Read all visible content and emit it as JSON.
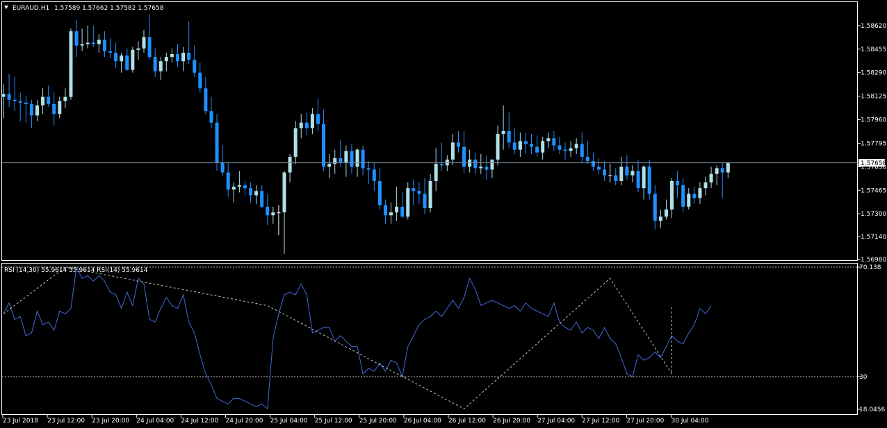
{
  "header": {
    "symbol": "EURAUD,H1",
    "ohlc": "1.57589 1.57662 1.57582 1.57658"
  },
  "price_axis": {
    "ticks": [
      "1.58620",
      "1.58455",
      "1.58290",
      "1.58125",
      "1.57960",
      "1.57795",
      "1.57630",
      "1.57465",
      "1.57300",
      "1.57140",
      "1.56980"
    ],
    "current": "1.57658"
  },
  "rsi": {
    "label": "RSI (14,30) 55.9614 55.9614  RSI(14) 55.9614",
    "ticks": [
      "70.138",
      "30",
      "18.0456"
    ]
  },
  "time_axis": {
    "labels": [
      "23 Jul 2018",
      "23 Jul 12:00",
      "23 Jul 20:00",
      "24 Jul 04:00",
      "24 Jul 12:00",
      "24 Jul 20:00",
      "25 Jul 04:00",
      "25 Jul 12:00",
      "25 Jul 20:00",
      "26 Jul 04:00",
      "26 Jul 12:00",
      "26 Jul 20:00",
      "27 Jul 04:00",
      "27 Jul 12:00",
      "27 Jul 20:00",
      "30 Jul 04:00"
    ]
  },
  "colors": {
    "bull": "#b0e0e6",
    "bear": "#1e90ff",
    "doji": "#ffffff",
    "rsi_line": "#4169e1",
    "price_line": "#778899",
    "axis": "#ffffff"
  },
  "chart_data": [
    {
      "type": "candlestick",
      "title": "EURAUD,H1",
      "ylim": [
        1.5698,
        1.5878
      ],
      "candles": [
        [
          1.5812,
          1.5821,
          1.5797,
          1.5814
        ],
        [
          1.5814,
          1.5828,
          1.5805,
          1.581
        ],
        [
          1.581,
          1.5826,
          1.5802,
          1.5809
        ],
        [
          1.5809,
          1.5815,
          1.5795,
          1.5808
        ],
        [
          1.5808,
          1.5813,
          1.5794,
          1.5807
        ],
        [
          1.5807,
          1.581,
          1.579,
          1.5799
        ],
        [
          1.5799,
          1.581,
          1.5795,
          1.5806
        ],
        [
          1.5806,
          1.5818,
          1.58,
          1.5812
        ],
        [
          1.5812,
          1.582,
          1.5805,
          1.5807
        ],
        [
          1.5807,
          1.5815,
          1.5792,
          1.58
        ],
        [
          1.58,
          1.5812,
          1.5797,
          1.5809
        ],
        [
          1.5809,
          1.5818,
          1.5804,
          1.5812
        ],
        [
          1.5812,
          1.586,
          1.581,
          1.5858
        ],
        [
          1.5858,
          1.5866,
          1.584,
          1.5848
        ],
        [
          1.5848,
          1.586,
          1.5844,
          1.5849
        ],
        [
          1.5849,
          1.5862,
          1.5846,
          1.585
        ],
        [
          1.585,
          1.5862,
          1.5847,
          1.5849
        ],
        [
          1.5849,
          1.5856,
          1.5843,
          1.5852
        ],
        [
          1.5852,
          1.5858,
          1.584,
          1.5844
        ],
        [
          1.5844,
          1.5853,
          1.5839,
          1.5843
        ],
        [
          1.5843,
          1.585,
          1.5832,
          1.5837
        ],
        [
          1.5837,
          1.5843,
          1.5829,
          1.5841
        ],
        [
          1.5841,
          1.5846,
          1.583,
          1.5831
        ],
        [
          1.5831,
          1.5847,
          1.5829,
          1.5845
        ],
        [
          1.5845,
          1.5851,
          1.5838,
          1.5846
        ],
        [
          1.5846,
          1.5859,
          1.5843,
          1.5854
        ],
        [
          1.5854,
          1.587,
          1.5838,
          1.584
        ],
        [
          1.584,
          1.5846,
          1.5826,
          1.583
        ],
        [
          1.583,
          1.584,
          1.5824,
          1.5837
        ],
        [
          1.5837,
          1.5843,
          1.583,
          1.584
        ],
        [
          1.584,
          1.5846,
          1.5836,
          1.5842
        ],
        [
          1.5842,
          1.5849,
          1.5833,
          1.5837
        ],
        [
          1.5837,
          1.5847,
          1.583,
          1.5843
        ],
        [
          1.5843,
          1.5865,
          1.5835,
          1.5838
        ],
        [
          1.5838,
          1.5848,
          1.5826,
          1.5829
        ],
        [
          1.5829,
          1.5836,
          1.5815,
          1.5818
        ],
        [
          1.5818,
          1.5826,
          1.58,
          1.5802
        ],
        [
          1.5802,
          1.5812,
          1.579,
          1.5794
        ],
        [
          1.5794,
          1.58,
          1.576,
          1.5766
        ],
        [
          1.5766,
          1.5778,
          1.5757,
          1.5759
        ],
        [
          1.5759,
          1.5766,
          1.5742,
          1.5747
        ],
        [
          1.5747,
          1.5752,
          1.5738,
          1.5749
        ],
        [
          1.5749,
          1.576,
          1.5745,
          1.575
        ],
        [
          1.575,
          1.5753,
          1.5743,
          1.5748
        ],
        [
          1.5748,
          1.5752,
          1.5738,
          1.5743
        ],
        [
          1.5743,
          1.575,
          1.5737,
          1.5746
        ],
        [
          1.5746,
          1.575,
          1.5734,
          1.5735
        ],
        [
          1.5735,
          1.5744,
          1.5722,
          1.5729
        ],
        [
          1.5729,
          1.5735,
          1.5723,
          1.5731
        ],
        [
          1.5731,
          1.5736,
          1.5715,
          1.5731
        ],
        [
          1.5731,
          1.576,
          1.5702,
          1.5759
        ],
        [
          1.5759,
          1.5772,
          1.5752,
          1.577
        ],
        [
          1.577,
          1.5795,
          1.5765,
          1.579
        ],
        [
          1.579,
          1.58,
          1.5783,
          1.5794
        ],
        [
          1.5794,
          1.5801,
          1.5785,
          1.579
        ],
        [
          1.579,
          1.5804,
          1.5786,
          1.58
        ],
        [
          1.58,
          1.5811,
          1.5788,
          1.5793
        ],
        [
          1.5793,
          1.5803,
          1.576,
          1.5763
        ],
        [
          1.5763,
          1.5772,
          1.5755,
          1.5765
        ],
        [
          1.5765,
          1.5775,
          1.5758,
          1.5769
        ],
        [
          1.5769,
          1.5782,
          1.5763,
          1.5766
        ],
        [
          1.5766,
          1.5778,
          1.5756,
          1.5774
        ],
        [
          1.5774,
          1.5779,
          1.5758,
          1.5763
        ],
        [
          1.5763,
          1.5776,
          1.5756,
          1.5775
        ],
        [
          1.5775,
          1.5778,
          1.5757,
          1.5762
        ],
        [
          1.5762,
          1.5767,
          1.5751,
          1.5761
        ],
        [
          1.5761,
          1.5766,
          1.5746,
          1.5753
        ],
        [
          1.5753,
          1.5762,
          1.5733,
          1.5736
        ],
        [
          1.5736,
          1.574,
          1.5723,
          1.5729
        ],
        [
          1.5729,
          1.5738,
          1.5723,
          1.5731
        ],
        [
          1.5731,
          1.5749,
          1.5725,
          1.5735
        ],
        [
          1.5735,
          1.5745,
          1.5727,
          1.5728
        ],
        [
          1.5728,
          1.5752,
          1.5726,
          1.5748
        ],
        [
          1.5748,
          1.5754,
          1.5736,
          1.5746
        ],
        [
          1.5746,
          1.5752,
          1.5737,
          1.5744
        ],
        [
          1.5744,
          1.5755,
          1.573,
          1.5734
        ],
        [
          1.5734,
          1.5758,
          1.5731,
          1.5753
        ],
        [
          1.5753,
          1.5776,
          1.5746,
          1.5765
        ],
        [
          1.5765,
          1.578,
          1.576,
          1.5764
        ],
        [
          1.5764,
          1.5771,
          1.576,
          1.5768
        ],
        [
          1.5768,
          1.5786,
          1.5764,
          1.578
        ],
        [
          1.578,
          1.5788,
          1.5773,
          1.5777
        ],
        [
          1.5777,
          1.5788,
          1.5758,
          1.5763
        ],
        [
          1.5763,
          1.5775,
          1.5759,
          1.5768
        ],
        [
          1.5768,
          1.5773,
          1.5758,
          1.5762
        ],
        [
          1.5762,
          1.5772,
          1.5758,
          1.5763
        ],
        [
          1.5763,
          1.5771,
          1.5754,
          1.5761
        ],
        [
          1.5761,
          1.5768,
          1.5755,
          1.5768
        ],
        [
          1.5768,
          1.5792,
          1.5764,
          1.5786
        ],
        [
          1.5786,
          1.5806,
          1.5775,
          1.5788
        ],
        [
          1.5788,
          1.5801,
          1.5776,
          1.578
        ],
        [
          1.578,
          1.579,
          1.5772,
          1.5775
        ],
        [
          1.5775,
          1.5787,
          1.577,
          1.5781
        ],
        [
          1.5781,
          1.5787,
          1.5772,
          1.5779
        ],
        [
          1.5779,
          1.5786,
          1.5772,
          1.5777
        ],
        [
          1.5777,
          1.5785,
          1.577,
          1.5773
        ],
        [
          1.5773,
          1.5784,
          1.5768,
          1.5781
        ],
        [
          1.5781,
          1.5787,
          1.5776,
          1.5783
        ],
        [
          1.5783,
          1.5788,
          1.5774,
          1.5778
        ],
        [
          1.5778,
          1.5784,
          1.5772,
          1.5775
        ],
        [
          1.5775,
          1.578,
          1.5768,
          1.5774
        ],
        [
          1.5774,
          1.5781,
          1.577,
          1.5776
        ],
        [
          1.5776,
          1.5783,
          1.5772,
          1.5779
        ],
        [
          1.5779,
          1.5787,
          1.5766,
          1.577
        ],
        [
          1.577,
          1.5781,
          1.5765,
          1.5767
        ],
        [
          1.5767,
          1.5773,
          1.576,
          1.5763
        ],
        [
          1.5763,
          1.5769,
          1.5758,
          1.5761
        ],
        [
          1.5761,
          1.5767,
          1.5753,
          1.5757
        ],
        [
          1.5757,
          1.5765,
          1.5752,
          1.5757
        ],
        [
          1.5757,
          1.5762,
          1.575,
          1.5753
        ],
        [
          1.5753,
          1.577,
          1.575,
          1.5763
        ],
        [
          1.5763,
          1.5771,
          1.5754,
          1.5757
        ],
        [
          1.5757,
          1.5764,
          1.5752,
          1.576
        ],
        [
          1.576,
          1.5768,
          1.5745,
          1.5748
        ],
        [
          1.5748,
          1.5764,
          1.574,
          1.5763
        ],
        [
          1.5763,
          1.5768,
          1.574,
          1.5744
        ],
        [
          1.5744,
          1.575,
          1.5719,
          1.5725
        ],
        [
          1.5725,
          1.5733,
          1.572,
          1.5728
        ],
        [
          1.5728,
          1.574,
          1.5726,
          1.5733
        ],
        [
          1.5733,
          1.5755,
          1.5727,
          1.5753
        ],
        [
          1.5753,
          1.576,
          1.5741,
          1.575
        ],
        [
          1.575,
          1.5755,
          1.5731,
          1.5735
        ],
        [
          1.5735,
          1.5748,
          1.5733,
          1.5744
        ],
        [
          1.5744,
          1.5749,
          1.5737,
          1.5741
        ],
        [
          1.5741,
          1.5752,
          1.5737,
          1.5748
        ],
        [
          1.5748,
          1.5756,
          1.5743,
          1.5752
        ],
        [
          1.5752,
          1.5763,
          1.5748,
          1.5758
        ],
        [
          1.5758,
          1.5764,
          1.575,
          1.5762
        ],
        [
          1.5762,
          1.5766,
          1.5741,
          1.5759
        ],
        [
          1.5759,
          1.5766,
          1.5755,
          1.5766
        ]
      ],
      "last_price": 1.57658
    },
    {
      "type": "line",
      "title": "RSI (14,30) 55.9614 55.9614  RSI(14) 55.9614",
      "ylim": [
        18.0456,
        70.138
      ],
      "levels": [
        70.138,
        30
      ],
      "series": [
        {
          "values": [
            53,
            57,
            51,
            52,
            45,
            46,
            54,
            49,
            50,
            47,
            54,
            53,
            55,
            70.1,
            66,
            67,
            65,
            67,
            65,
            61,
            60,
            55,
            61,
            56,
            66,
            64,
            51,
            50,
            55,
            59,
            56,
            55,
            60,
            50,
            46,
            38,
            31,
            27,
            22,
            21,
            20,
            22,
            22,
            21,
            20,
            19,
            20,
            18.2,
            44,
            53,
            60,
            61,
            60,
            64,
            60,
            46,
            47,
            48,
            48,
            43,
            45,
            43,
            41,
            41,
            31,
            33,
            32,
            35,
            32,
            36,
            35,
            30,
            41,
            45,
            49,
            51,
            52,
            54,
            52,
            55,
            58,
            55,
            59,
            66,
            62,
            56,
            57,
            58,
            57,
            56,
            55,
            56,
            54,
            57,
            55,
            54,
            53,
            52,
            57,
            50,
            48,
            47,
            50,
            46,
            48,
            47,
            44,
            48,
            44,
            42,
            37,
            31,
            30,
            38,
            36,
            37,
            39,
            37,
            41,
            45,
            43,
            42,
            46,
            49,
            55,
            53,
            56
          ]
        },
        {
          "values": [
            53,
            70.1,
            56,
            18.2,
            66,
            31,
            56
          ]
        }
      ]
    }
  ]
}
